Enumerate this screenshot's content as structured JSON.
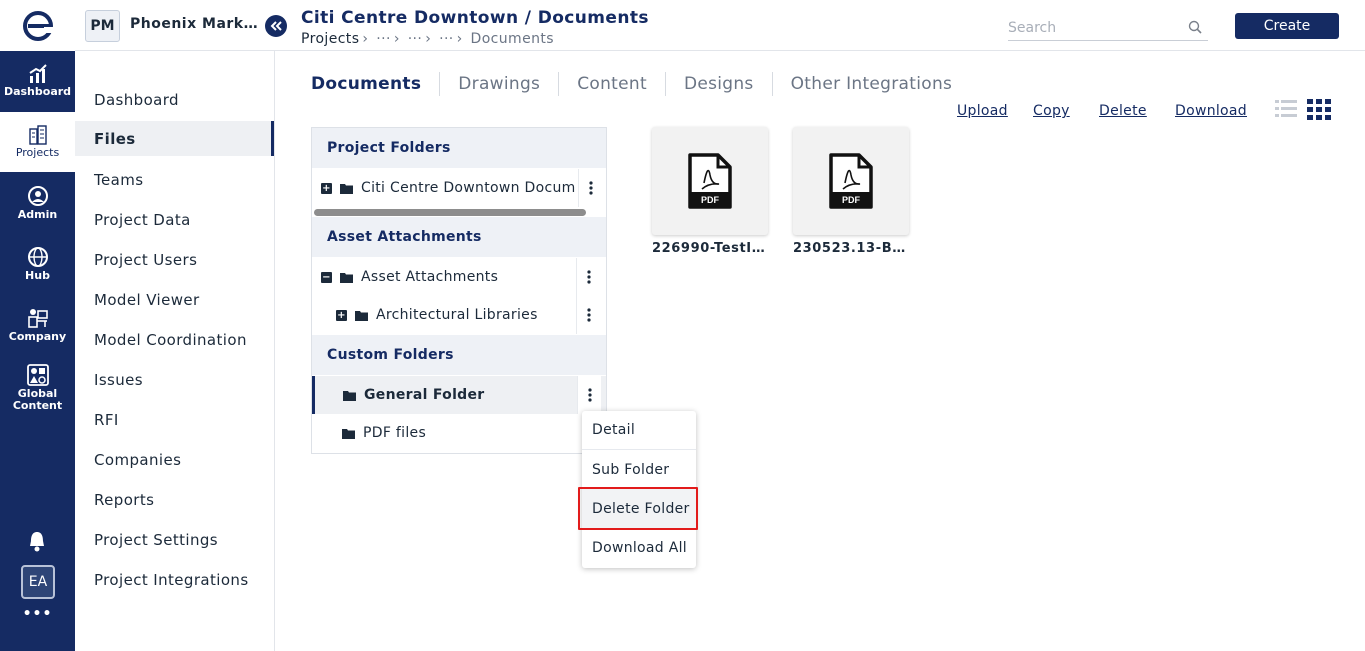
{
  "rail": {
    "items": [
      {
        "label": "Dashboard",
        "icon": "chart-icon"
      },
      {
        "label": "Projects",
        "icon": "buildings-icon"
      },
      {
        "label": "Admin",
        "icon": "user-circle-icon"
      },
      {
        "label": "Hub",
        "icon": "globe-icon"
      },
      {
        "label": "Company",
        "icon": "company-icon"
      },
      {
        "label": "Global Content",
        "icon": "shapes-icon"
      }
    ],
    "avatar": "EA",
    "more": "•••"
  },
  "project": {
    "badge": "PM",
    "name": "Phoenix Mark…"
  },
  "sidebar": {
    "items": [
      {
        "label": "Dashboard"
      },
      {
        "label": "Files"
      },
      {
        "label": "Teams"
      },
      {
        "label": "Project Data"
      },
      {
        "label": "Project Users"
      },
      {
        "label": "Model Viewer"
      },
      {
        "label": "Model Coordination"
      },
      {
        "label": "Issues"
      },
      {
        "label": "RFI"
      },
      {
        "label": "Companies"
      },
      {
        "label": "Reports"
      },
      {
        "label": "Project Settings"
      },
      {
        "label": "Project Integrations"
      }
    ]
  },
  "header": {
    "title": "Citi Centre Downtown / Documents",
    "breadcrumb": {
      "root": "Projects",
      "ellipsis": "···",
      "current": "Documents"
    },
    "search_placeholder": "Search",
    "create_label": "Create"
  },
  "tabs": [
    {
      "label": "Documents"
    },
    {
      "label": "Drawings"
    },
    {
      "label": "Content"
    },
    {
      "label": "Designs"
    },
    {
      "label": "Other Integrations"
    }
  ],
  "actions": {
    "upload": "Upload",
    "copy": "Copy",
    "delete": "Delete",
    "download": "Download"
  },
  "tree": {
    "project_folders_header": "Project Folders",
    "project_folder": "Citi Centre Downtown Docume",
    "asset_header": "Asset Attachments",
    "asset_root": "Asset Attachments",
    "asset_child": "Architectural Libraries",
    "custom_header": "Custom Folders",
    "custom_folder_1": "General Folder",
    "custom_folder_2": "PDF files"
  },
  "context_menu": {
    "items": [
      {
        "label": "Detail"
      },
      {
        "label": "Sub Folder"
      },
      {
        "label": "Delete Folder"
      },
      {
        "label": "Download All"
      }
    ]
  },
  "files": [
    {
      "name": "226990-TestI…",
      "type_label": "PDF"
    },
    {
      "name": "230523.13-B…",
      "type_label": "PDF"
    }
  ]
}
